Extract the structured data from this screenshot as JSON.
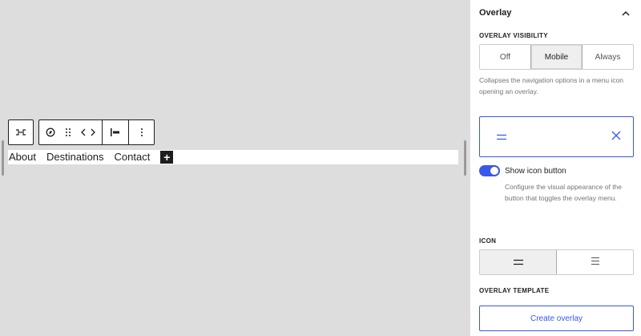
{
  "canvas": {
    "navigation": {
      "links": [
        {
          "label": "About"
        },
        {
          "label": "Destinations"
        },
        {
          "label": "Contact"
        }
      ],
      "add_block_symbol": "+"
    },
    "toolbar": {
      "icons": [
        "navigation-block-icon",
        "compass-icon",
        "drag-handle-icon",
        "move-arrows-icon",
        "justify-left-icon",
        "more-options-icon"
      ]
    }
  },
  "sidebar": {
    "panel_title": "Overlay",
    "overlay_visibility": {
      "label": "OVERLAY VISIBILITY",
      "options": [
        "Off",
        "Mobile",
        "Always"
      ],
      "selected": "Mobile",
      "help": "Collapses the navigation options in a menu icon opening an overlay."
    },
    "show_icon_button": {
      "label": "Show icon button",
      "enabled": true,
      "help": "Configure the visual appearance of the button that toggles the overlay menu."
    },
    "icon": {
      "label": "ICON",
      "options": [
        "two-line-menu-icon",
        "three-line-menu-icon"
      ],
      "selected": "two-line-menu-icon"
    },
    "overlay_template": {
      "label": "OVERLAY TEMPLATE",
      "button_label": "Create overlay"
    }
  },
  "colors": {
    "accent": "#3858e9",
    "canvas_bg": "#dddddd",
    "text": "#1e1e1e",
    "muted": "#757575"
  }
}
